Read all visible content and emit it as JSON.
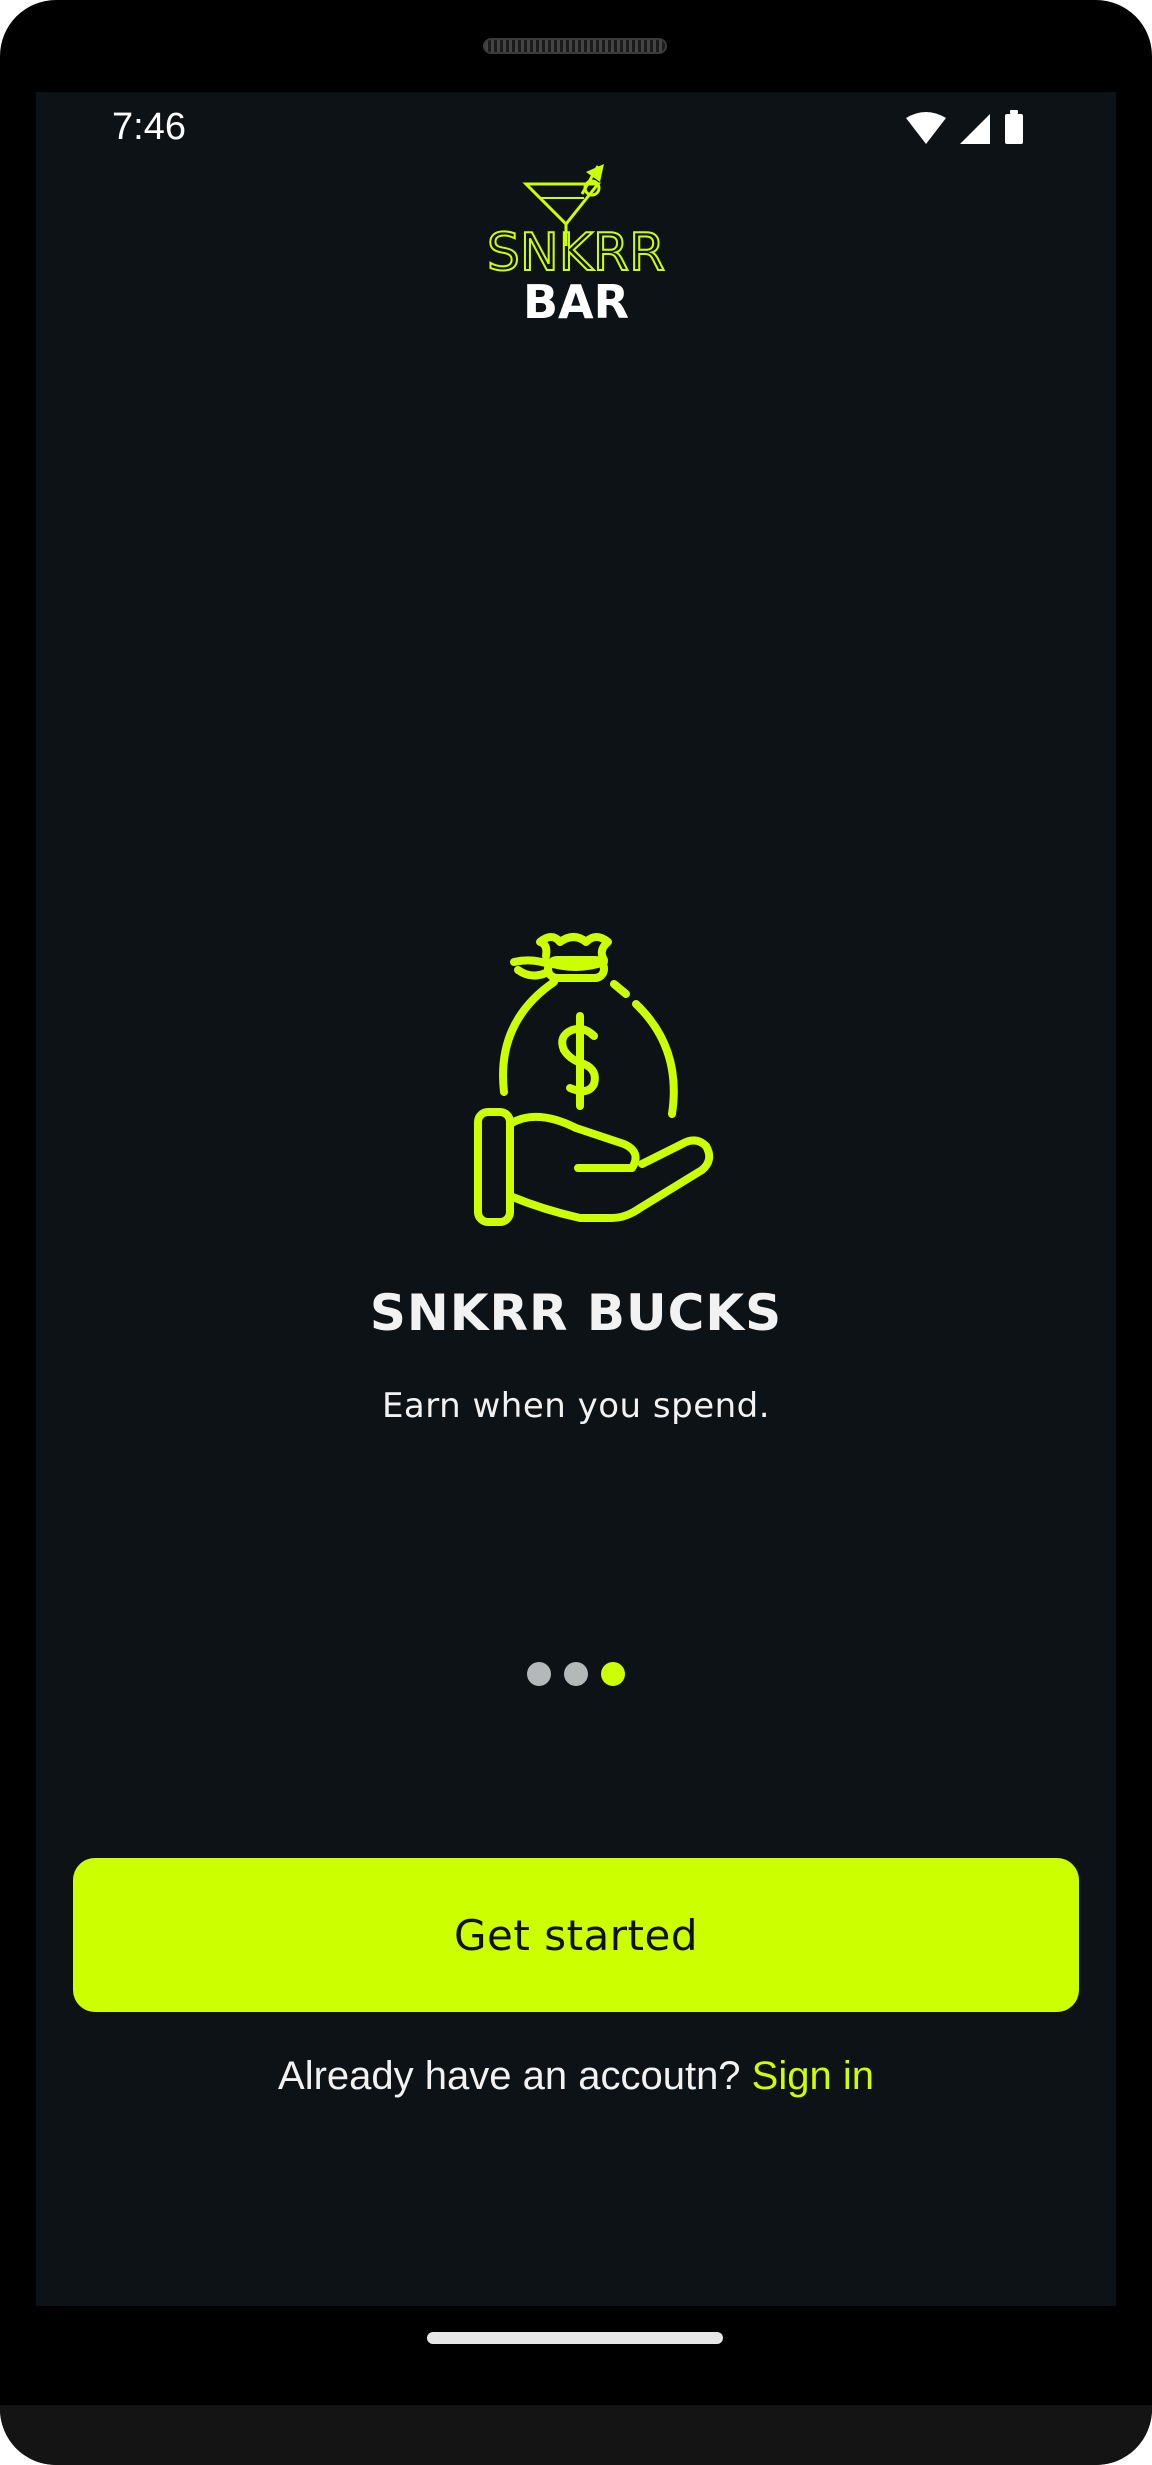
{
  "status_bar": {
    "time": "7:46",
    "icons": [
      "wifi-icon",
      "signal-icon",
      "battery-icon"
    ]
  },
  "logo": {
    "line1": "SNKRR",
    "line2": "BAR",
    "icon": "cocktail-glass-icon"
  },
  "onboarding": {
    "illustration_icon": "money-bag-hand-icon",
    "title": "SNKRR BUCKS",
    "subtitle": "Earn when you spend.",
    "page_count": 3,
    "active_page": 3
  },
  "actions": {
    "get_started_label": "Get started",
    "signin_prompt": "Already have an accoutn?",
    "signin_link": "Sign in"
  },
  "colors": {
    "accent": "#ccff00",
    "background": "#0d1216",
    "text": "#f2f2f2",
    "dot_inactive": "#b5b8b9"
  }
}
